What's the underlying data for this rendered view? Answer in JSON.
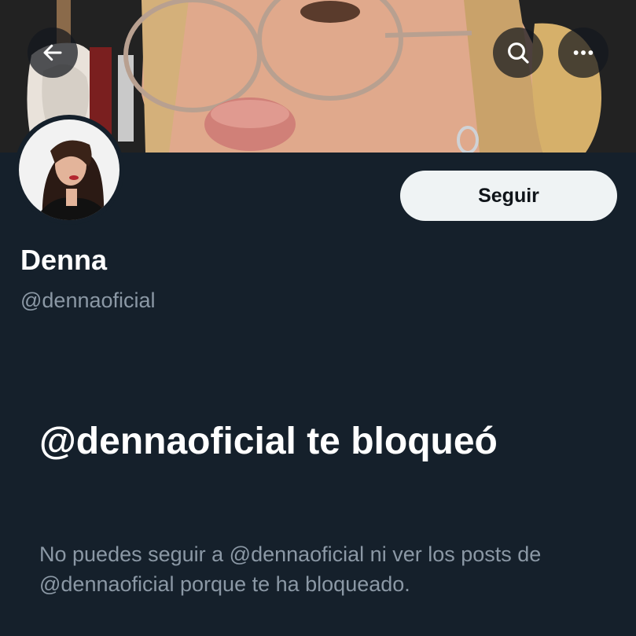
{
  "header": {
    "back_icon": "arrow-left-icon",
    "search_icon": "search-icon",
    "more_icon": "more-horizontal-icon"
  },
  "profile": {
    "display_name": "Denna",
    "handle": "@dennaoficial",
    "follow_label": "Seguir"
  },
  "blocked": {
    "title": "@dennaoficial te bloqueó",
    "description": "No puedes seguir a @dennaoficial ni ver los posts de @dennaoficial porque te ha bloqueado."
  },
  "colors": {
    "background": "#15202b",
    "primary_text": "#ffffff",
    "secondary_text": "#8b98a5",
    "follow_button_bg": "#eff3f4",
    "follow_button_text": "#0f1419"
  }
}
